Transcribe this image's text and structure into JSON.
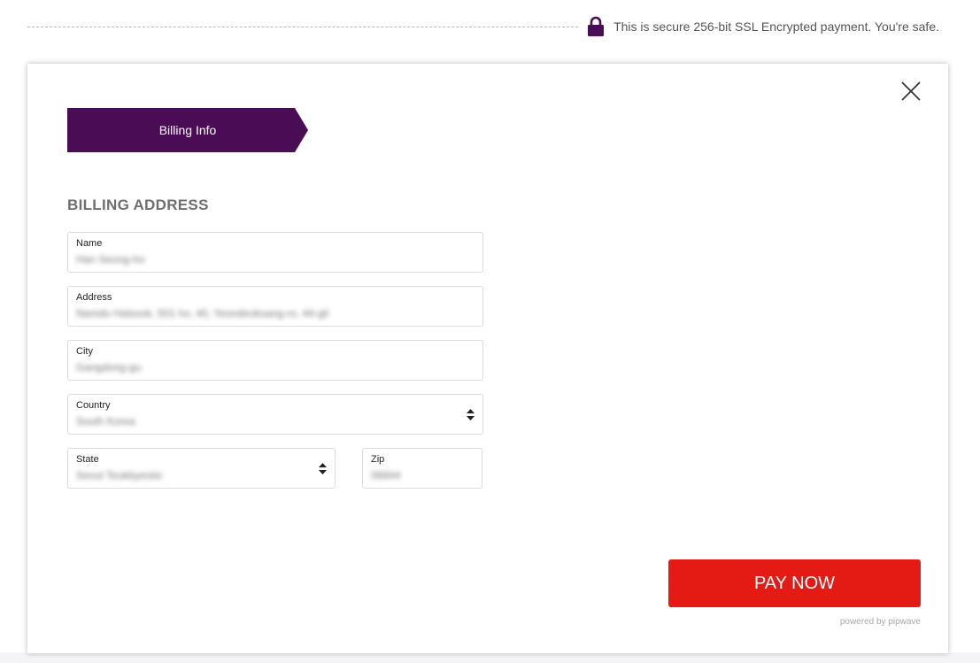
{
  "security": {
    "icon": "lock-icon",
    "text": "This is secure 256-bit SSL Encrypted payment. You're safe."
  },
  "modal": {
    "close_icon": "close-icon",
    "step_tab": "Billing Info",
    "section_title": "BILLING ADDRESS",
    "fields": {
      "name": {
        "label": "Name",
        "value": "Han Seong-ho"
      },
      "address": {
        "label": "Address",
        "value": "Namdo Halsook, 501 ho, 40, Yeondeoksang-ro, 44-gil"
      },
      "city": {
        "label": "City",
        "value": "Gangdong-gu"
      },
      "country": {
        "label": "Country",
        "value": "South Korea"
      },
      "state": {
        "label": "State",
        "value": "Seoul Teukbyeolsi"
      },
      "zip": {
        "label": "Zip",
        "value": "06844"
      }
    },
    "pay_button": "PAY NOW",
    "powered_by": "powered by pipwave"
  },
  "colors": {
    "brand_purple": "#4a0d55",
    "pay_red": "#e31b14"
  }
}
